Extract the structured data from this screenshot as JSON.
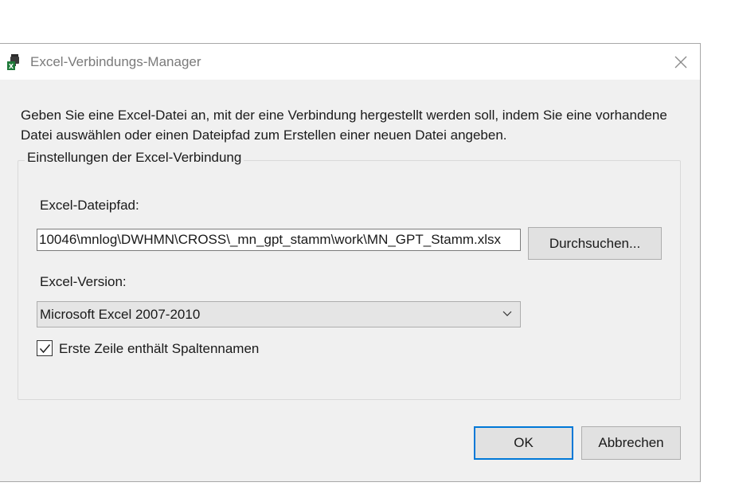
{
  "window": {
    "title": "Excel-Verbindungs-Manager",
    "icon": "excel-connection-icon",
    "close_icon": "close-icon"
  },
  "description": "Geben Sie eine Excel-Datei an, mit der eine Verbindung hergestellt werden soll, indem Sie eine vorhandene Datei auswählen oder einen Dateipfad zum Erstellen einer neuen Datei angeben.",
  "group": {
    "legend": "Einstellungen der Excel-Verbindung",
    "file_path_label": "Excel-Dateipfad:",
    "file_path_value": "10046\\mnlog\\DWHMN\\CROSS\\_mn_gpt_stamm\\work\\MN_GPT_Stamm.xlsx",
    "browse_label": "Durchsuchen...",
    "version_label": "Excel-Version:",
    "version_selected": "Microsoft Excel 2007-2010",
    "first_row_label": "Erste Zeile enthält Spaltennamen",
    "first_row_checked": true
  },
  "buttons": {
    "ok": "OK",
    "cancel": "Abbrechen"
  },
  "colors": {
    "dialog_bg": "#f0f0f0",
    "accent": "#0078d7"
  }
}
